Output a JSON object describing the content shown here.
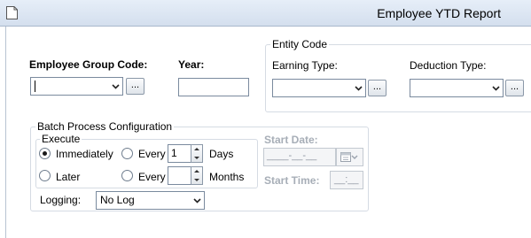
{
  "window": {
    "title": "Employee YTD Report"
  },
  "employee_group": {
    "label": "Employee Group Code:",
    "value": "",
    "browse_label": "..."
  },
  "year": {
    "label": "Year:",
    "value": ""
  },
  "entity_code": {
    "group_title": "Entity Code",
    "earning_type_label": "Earning Type:",
    "earning_type_value": "",
    "earning_browse_label": "...",
    "deduction_type_label": "Deduction Type:",
    "deduction_type_value": "",
    "deduction_browse_label": "..."
  },
  "batch": {
    "group_title": "Batch Process Configuration",
    "execute_title": "Execute",
    "immediately_label": "Immediately",
    "immediately_selected": true,
    "later_label": "Later",
    "later_selected": false,
    "every_days_label": "Every",
    "every_days_value": "1",
    "days_label": "Days",
    "every_months_label": "Every",
    "every_months_value": "",
    "months_label": "Months",
    "start_date_label": "Start Date:",
    "start_date_value": "____-__-__",
    "start_time_label": "Start Time:",
    "start_time_value": "__:__",
    "logging_label": "Logging:",
    "logging_value": "No Log"
  },
  "icons": {
    "document": "document-icon",
    "dropdown": "chevron-down-icon",
    "calendar": "calendar-icon",
    "spin_up": "spin-up-icon",
    "spin_down": "spin-down-icon"
  }
}
